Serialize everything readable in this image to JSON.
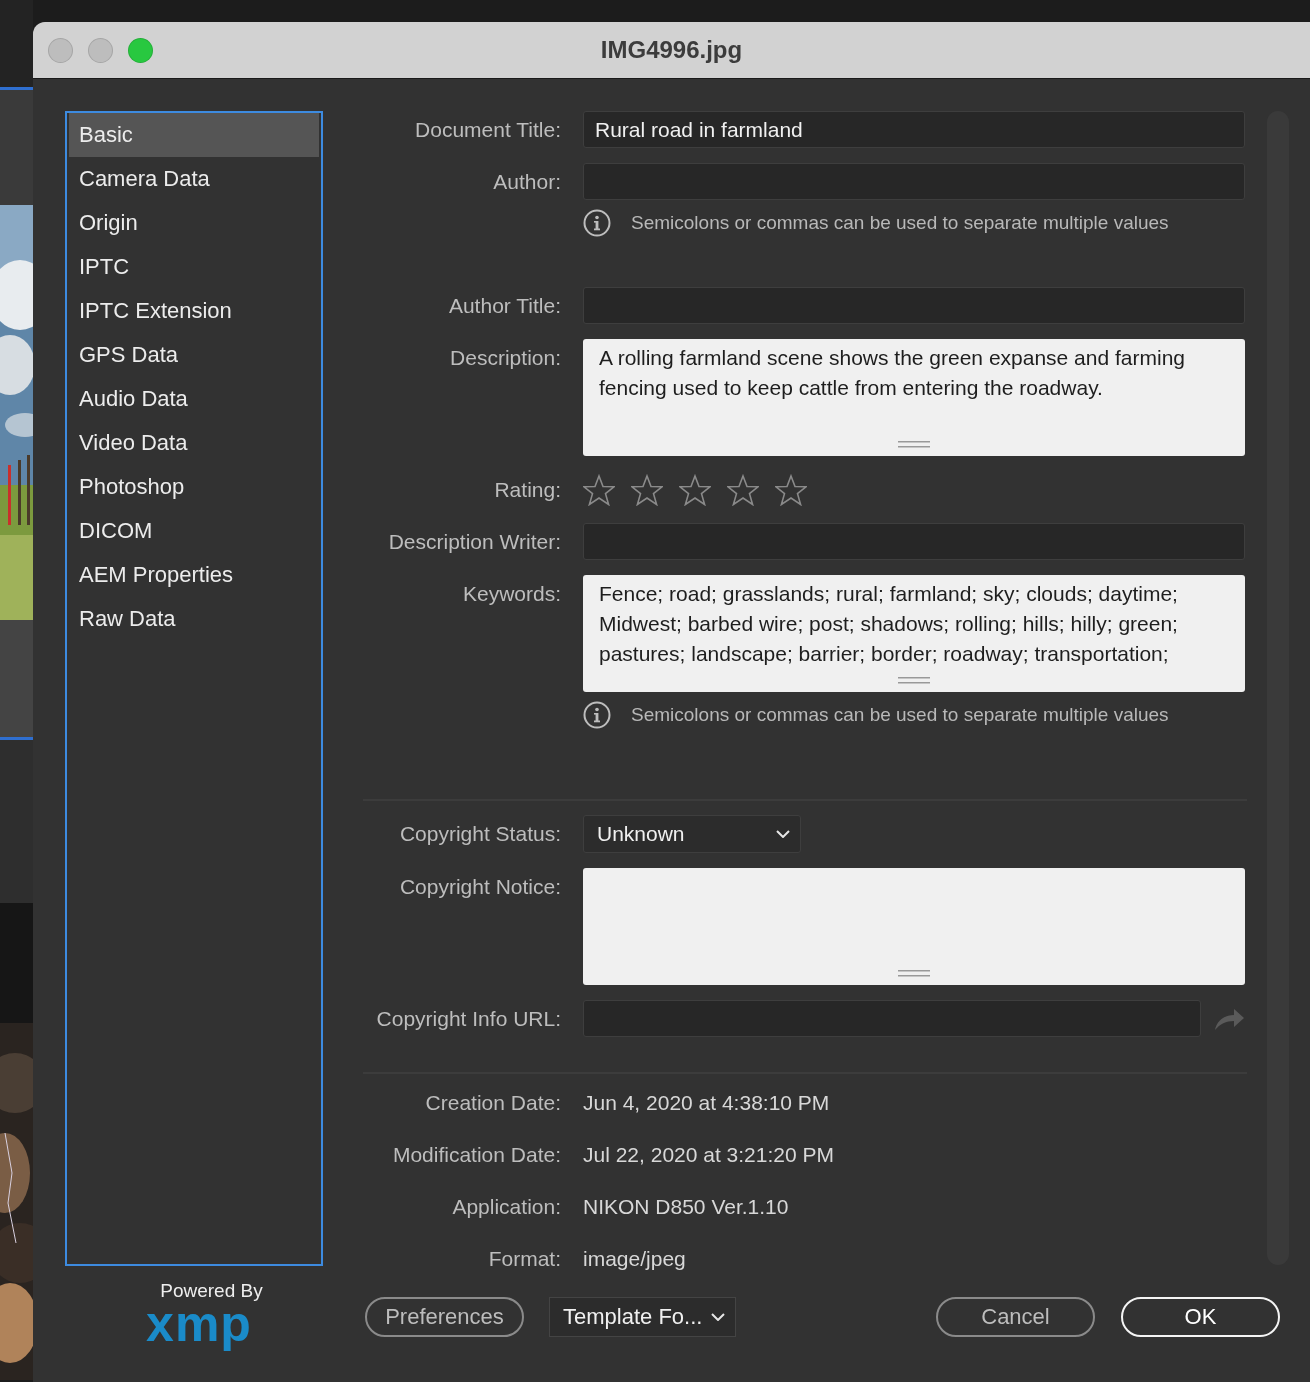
{
  "window": {
    "title": "IMG4996.jpg",
    "traffic_lights": [
      {
        "color": "#bdbdbd"
      },
      {
        "color": "#bdbdbd"
      },
      {
        "color": "#28c840"
      }
    ]
  },
  "sidebar": {
    "items": [
      {
        "label": "Basic",
        "selected": true
      },
      {
        "label": "Camera Data",
        "selected": false
      },
      {
        "label": "Origin",
        "selected": false
      },
      {
        "label": "IPTC",
        "selected": false
      },
      {
        "label": "IPTC Extension",
        "selected": false
      },
      {
        "label": "GPS Data",
        "selected": false
      },
      {
        "label": "Audio Data",
        "selected": false
      },
      {
        "label": "Video Data",
        "selected": false
      },
      {
        "label": "Photoshop",
        "selected": false
      },
      {
        "label": "DICOM",
        "selected": false
      },
      {
        "label": "AEM Properties",
        "selected": false
      },
      {
        "label": "Raw Data",
        "selected": false
      }
    ]
  },
  "form": {
    "rows": [
      {
        "kind": "text",
        "label": "Document Title:",
        "value": "Rural road in farmland"
      },
      {
        "kind": "text",
        "label": "Author:"
      },
      {
        "kind": "hint",
        "text": "Semicolons or commas can be used to separate multiple values"
      },
      {
        "kind": "text",
        "label": "Author Title:"
      },
      {
        "kind": "textarea",
        "label": "Description:",
        "value": "A rolling farmland scene shows the green expanse and farming fencing used to keep cattle from entering the roadway."
      },
      {
        "kind": "rating",
        "label": "Rating:",
        "stars": 0
      },
      {
        "kind": "text",
        "label": "Description Writer:"
      },
      {
        "kind": "textarea",
        "label": "Keywords:",
        "value": "Fence; road; grasslands; rural; farmland; sky; clouds; daytime; Midwest; barbed wire; post; shadows; rolling; hills; hilly; green; pastures; landscape; barrier; border; roadway; transportation;"
      },
      {
        "kind": "hint",
        "text": "Semicolons or commas can be used to separate multiple values"
      },
      {
        "kind": "divider"
      },
      {
        "kind": "dropdown",
        "label": "Copyright Status:",
        "value": "Unknown"
      },
      {
        "kind": "textarea",
        "label": "Copyright Notice:"
      },
      {
        "kind": "url",
        "label": "Copyright Info URL:"
      },
      {
        "kind": "divider"
      },
      {
        "kind": "info",
        "label": "Creation Date:",
        "value": "Jun 4, 2020 at 4:38:10 PM"
      },
      {
        "kind": "info",
        "label": "Modification Date:",
        "value": "Jul 22, 2020 at 3:21:20 PM"
      },
      {
        "kind": "info",
        "label": "Application:",
        "value": "NIKON D850 Ver.1.10"
      },
      {
        "kind": "info",
        "label": "Format:",
        "value": "image/jpeg"
      }
    ]
  },
  "footer": {
    "powered_by": "Powered By",
    "logo": "xmp",
    "buttons": [
      {
        "kind": "button",
        "label": "Preferences"
      },
      {
        "kind": "dropdown",
        "label": "Template Fo..."
      },
      {
        "kind": "button",
        "label": "Cancel"
      },
      {
        "kind": "default",
        "label": "OK"
      }
    ]
  }
}
